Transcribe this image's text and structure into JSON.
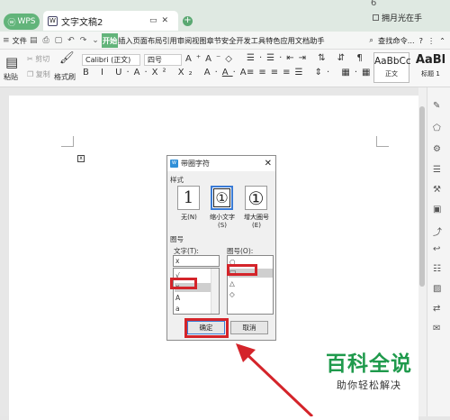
{
  "tabs": {
    "wps": "WPS",
    "doc": "文字文稿2",
    "add": "+"
  },
  "window": {
    "user": "拥月光在手",
    "bell": "6"
  },
  "menubar": {
    "file": "文件",
    "start": "开始",
    "insert": "插入",
    "layout": "页面布局",
    "ref": "引用",
    "review": "审阅",
    "view": "视图",
    "section": "章节",
    "security": "安全",
    "dev": "开发工具",
    "special": "特色应用",
    "docassist": "文档助手",
    "search": "查找命令..."
  },
  "ribbon": {
    "paste": "粘贴",
    "cut": "剪切",
    "copy": "复制",
    "format_painter": "格式刷",
    "font": "Calibri (正文)",
    "size": "四号"
  },
  "styles": [
    {
      "sample": "AaBbCc",
      "label": "正文"
    },
    {
      "sample": "AaBl",
      "label": "标题 1"
    }
  ],
  "document": {
    "mark": "x"
  },
  "dialog": {
    "title": "带圈字符",
    "style_label": "样式",
    "options": [
      {
        "glyph": "1",
        "label": "无(N)"
      },
      {
        "glyph": "①",
        "label": "缩小文字\n(S)"
      },
      {
        "glyph": "①",
        "label": "增大圈号\n(E)"
      }
    ],
    "enclose_label": "圈号",
    "text_label": "文字(T):",
    "text_value": "x",
    "text_items": [
      "√",
      "x",
      "A",
      "a"
    ],
    "circle_label": "圈号(O):",
    "circle_items": [
      "○",
      "□",
      "△",
      "◇"
    ],
    "ok": "确定",
    "cancel": "取消"
  },
  "watermark": {
    "title": "百科全说",
    "subtitle": "助你轻松解决"
  },
  "colors": {
    "wps_green": "#62b47a",
    "highlight_red": "#d4242a",
    "arrow_red": "#d4242a",
    "watermark_green": "#1f9a4c"
  }
}
